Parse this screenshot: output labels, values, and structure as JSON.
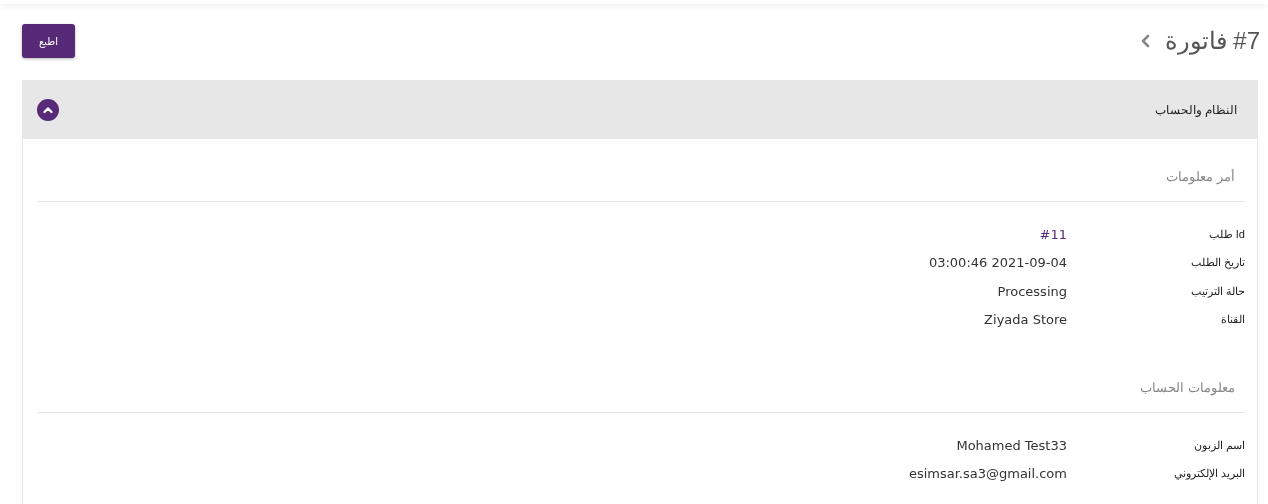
{
  "page_title": "#7 فاتورة",
  "print_button": "اطبع",
  "panel": {
    "title": "النظام والحساب",
    "expanded": true,
    "sections": [
      {
        "heading": "أمر معلومات",
        "rows": [
          {
            "label": "Id طلب",
            "value": "#11",
            "kind": "link"
          },
          {
            "label": "تاريخ الطلب",
            "value": "03:00:46 2021-09-04",
            "kind": "text"
          },
          {
            "label": "حالة الترتيب",
            "value": "Processing",
            "kind": "text"
          },
          {
            "label": "القناة",
            "value": "Ziyada Store",
            "kind": "text"
          }
        ]
      },
      {
        "heading": "معلومات الحساب",
        "rows": [
          {
            "label": "اسم الزبون",
            "value": "Mohamed Test33",
            "kind": "text"
          },
          {
            "label": "البريد الإلكتروني",
            "value": "esimsar.sa3@gmail.com",
            "kind": "text"
          }
        ]
      }
    ]
  }
}
